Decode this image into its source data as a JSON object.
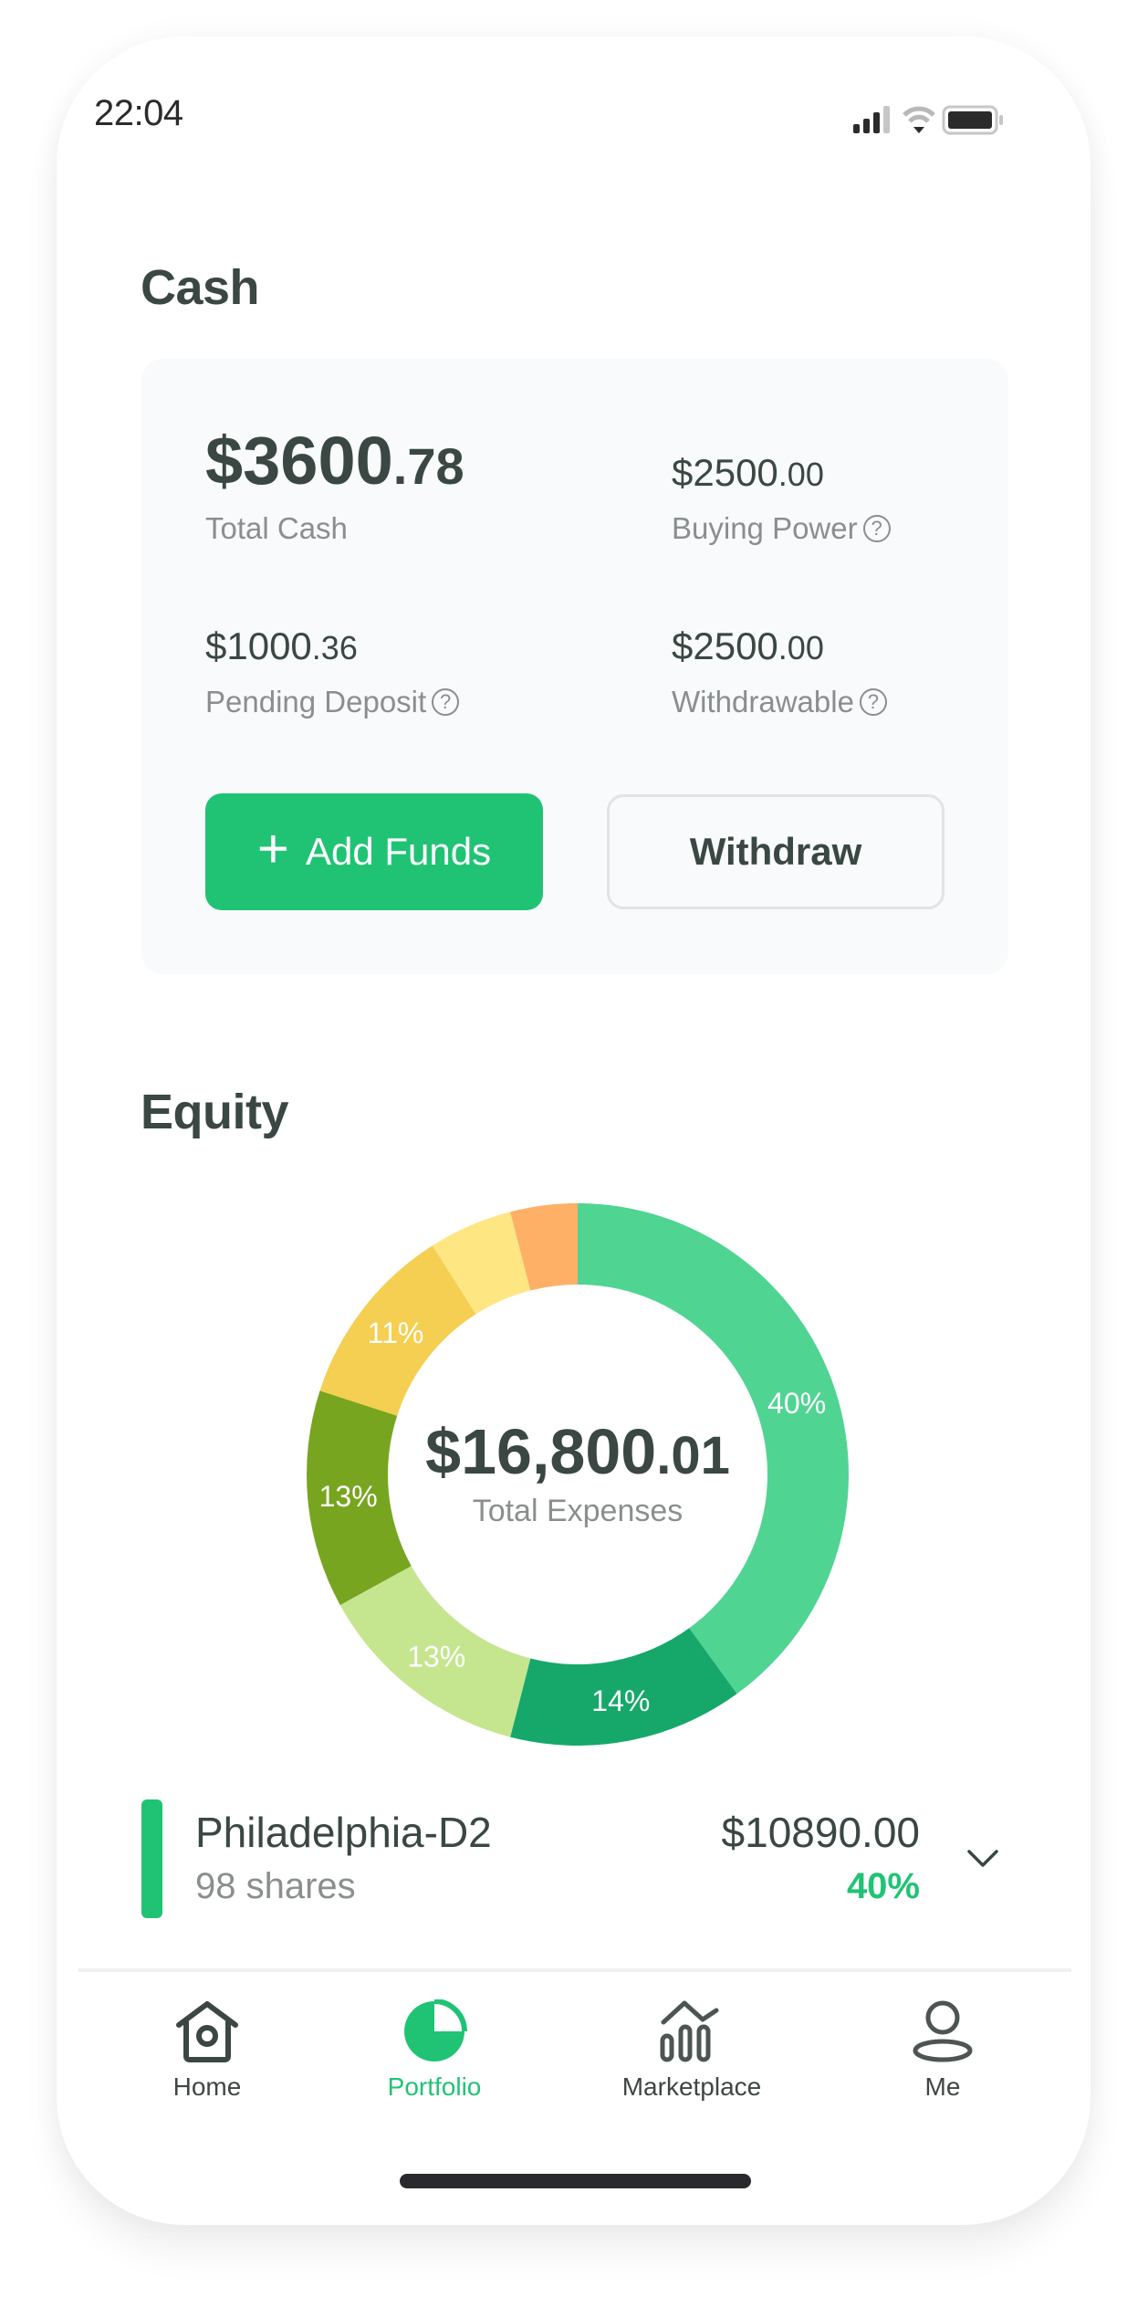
{
  "status_bar": {
    "time": "22:04",
    "signal_icon": "cellular-signal-icon",
    "wifi_icon": "wifi-icon",
    "battery_icon": "battery-icon"
  },
  "cash": {
    "title": "Cash",
    "total_cash": {
      "whole": "$3600",
      "cents": ".78",
      "label": "Total Cash"
    },
    "buying_power": {
      "whole": "$2500",
      "cents": ".00",
      "label": "Buying Power",
      "help_icon": "?"
    },
    "pending_deposit": {
      "whole": "$1000",
      "cents": ".36",
      "label": "Pending Deposit",
      "help_icon": "?"
    },
    "withdrawable": {
      "whole": "$2500",
      "cents": ".00",
      "label": "Withdrawable",
      "help_icon": "?"
    },
    "add_funds_label": "Add Funds",
    "add_funds_icon": "+",
    "withdraw_label": "Withdraw"
  },
  "equity": {
    "title": "Equity",
    "total": {
      "whole": "$16,800",
      "cents": ".01",
      "label": "Total Expenses"
    },
    "holdings": [
      {
        "name": "Philadelphia-D2",
        "shares": "98 shares",
        "amount": "$10890.00",
        "percent": "40%",
        "color": "#20c374"
      }
    ]
  },
  "chart_data": {
    "type": "pie",
    "variant": "donut",
    "title": "",
    "center_text": "$16,800.01",
    "center_label": "Total Expenses",
    "start": "top",
    "direction": "clockwise",
    "slices": [
      {
        "value": 40,
        "label": "40%",
        "color": "#50d492"
      },
      {
        "value": 14,
        "label": "14%",
        "color": "#16a86a"
      },
      {
        "value": 13,
        "label": "13%",
        "color": "#c5e58f"
      },
      {
        "value": 13,
        "label": "13%",
        "color": "#78a520"
      },
      {
        "value": 11,
        "label": "11%",
        "color": "#f4cf52"
      },
      {
        "value": 5,
        "label": "",
        "color": "#fee683"
      },
      {
        "value": 4,
        "label": "",
        "color": "#feb067"
      }
    ]
  },
  "tab_bar": {
    "active": "Portfolio",
    "items": [
      {
        "label": "Home",
        "icon": "home-icon"
      },
      {
        "label": "Portfolio",
        "icon": "pie-chart-icon"
      },
      {
        "label": "Marketplace",
        "icon": "market-chart-icon"
      },
      {
        "label": "Me",
        "icon": "user-icon"
      }
    ]
  },
  "colors": {
    "accent": "#20c374",
    "text_primary": "#3a4742",
    "text_secondary": "#8a8f8d",
    "card_bg": "#f8fafb"
  }
}
